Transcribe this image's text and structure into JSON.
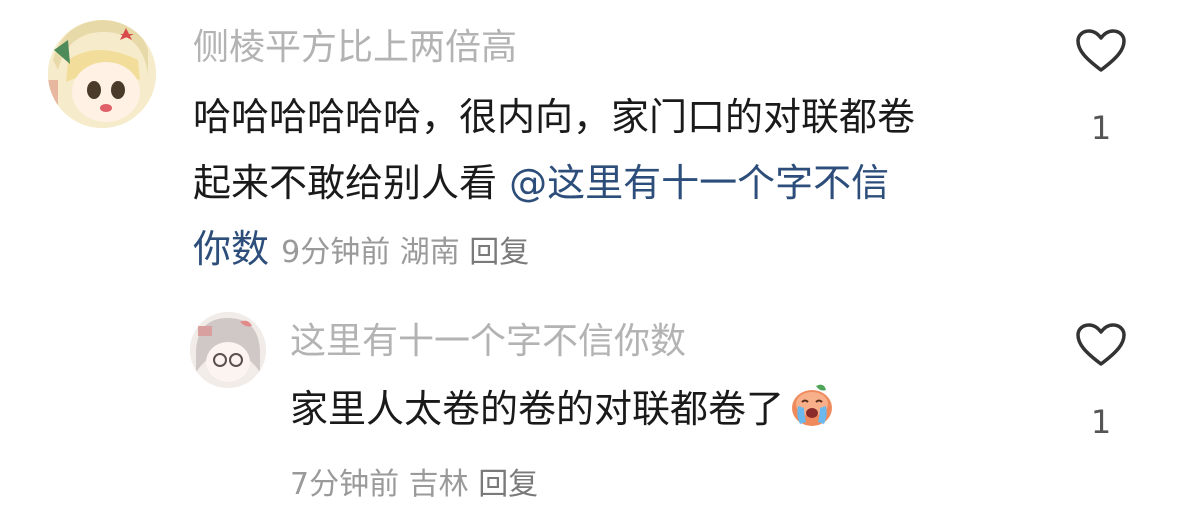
{
  "comments": [
    {
      "username": "侧棱平方比上两倍高",
      "lines": [
        "哈哈哈哈哈哈，很内向，家门口的对联都卷",
        "起来不敢给别人看 "
      ],
      "mention": "@这里有十一个字不信",
      "mention_cont": "你数",
      "time": "9分钟前",
      "location": "湖南",
      "reply_label": "回复",
      "likes": "1",
      "like_icon": "heart-outline-icon"
    },
    {
      "username": "这里有十一个字不信你数",
      "text": "家里人太卷的卷的对联都卷了",
      "emoji": "crying-face-icon",
      "time": "7分钟前",
      "location": "吉林",
      "reply_label": "回复",
      "likes": "1",
      "like_icon": "heart-outline-icon"
    }
  ],
  "colors": {
    "username": "#b3b3b3",
    "text": "#1a1a1a",
    "mention": "#2d4e7a",
    "meta": "#9a9a9a"
  }
}
